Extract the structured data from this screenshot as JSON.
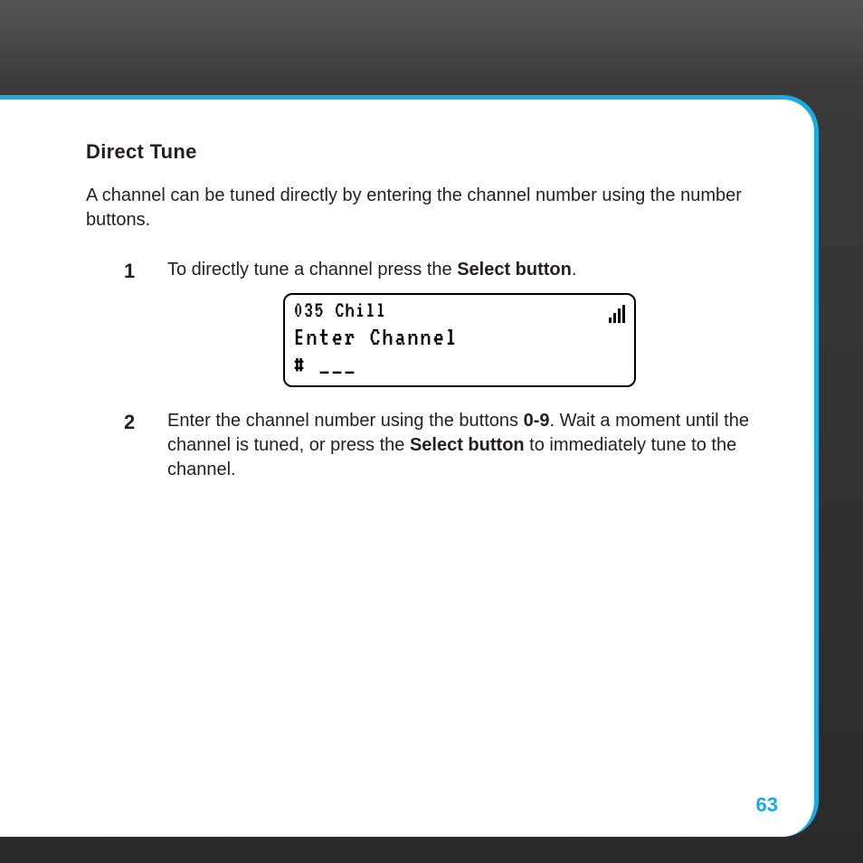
{
  "title": "Direct Tune",
  "intro": "A channel can be tuned directly by entering the channel number using the number buttons.",
  "steps": {
    "s1": {
      "pre": "To directly tune a channel press the ",
      "bold": "Select button",
      "post": "."
    },
    "s2": {
      "pre": "Enter the channel number using the buttons ",
      "bold1": "0-9",
      "mid": ". Wait a moment until the channel is tuned, or press the ",
      "bold2": "Select button",
      "post": " to immediately tune to the channel."
    }
  },
  "lcd": {
    "line1": "035 Chill",
    "line2": "Enter Channel",
    "line3": "# ___"
  },
  "page_number": "63"
}
